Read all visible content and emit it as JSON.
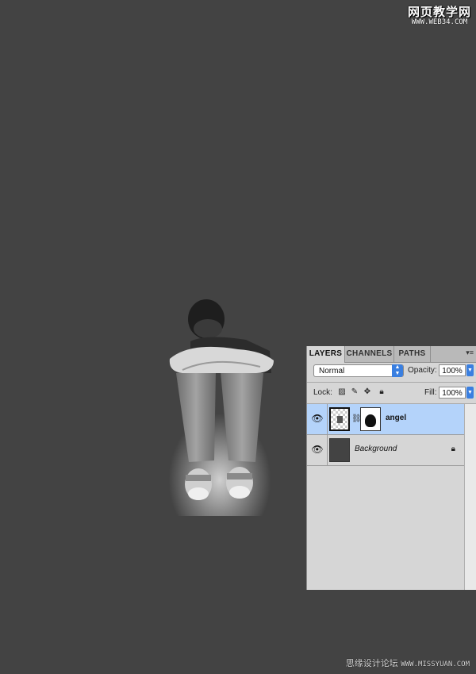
{
  "watermark_top": {
    "cn": "网页教学网",
    "en": "WWW.WEB34.COM"
  },
  "watermark_bottom": {
    "cn": "思缘设计论坛",
    "url": "WWW.MISSYUAN.COM"
  },
  "panel": {
    "tabs": [
      "LAYERS",
      "CHANNELS",
      "PATHS"
    ],
    "active_tab": "LAYERS",
    "blend_mode": "Normal",
    "opacity_label": "Opacity:",
    "opacity_value": "100%",
    "lock_label": "Lock:",
    "fill_label": "Fill:",
    "fill_value": "100%",
    "layers": [
      {
        "name": "angel",
        "selected": true,
        "visible": true,
        "has_mask": true
      },
      {
        "name": "Background",
        "selected": false,
        "visible": true,
        "locked": true
      }
    ]
  },
  "colors": {
    "canvas": "#434343",
    "panel": "#d6d6d6",
    "selection": "#b4d3fa",
    "accent": "#3a7fe0"
  }
}
